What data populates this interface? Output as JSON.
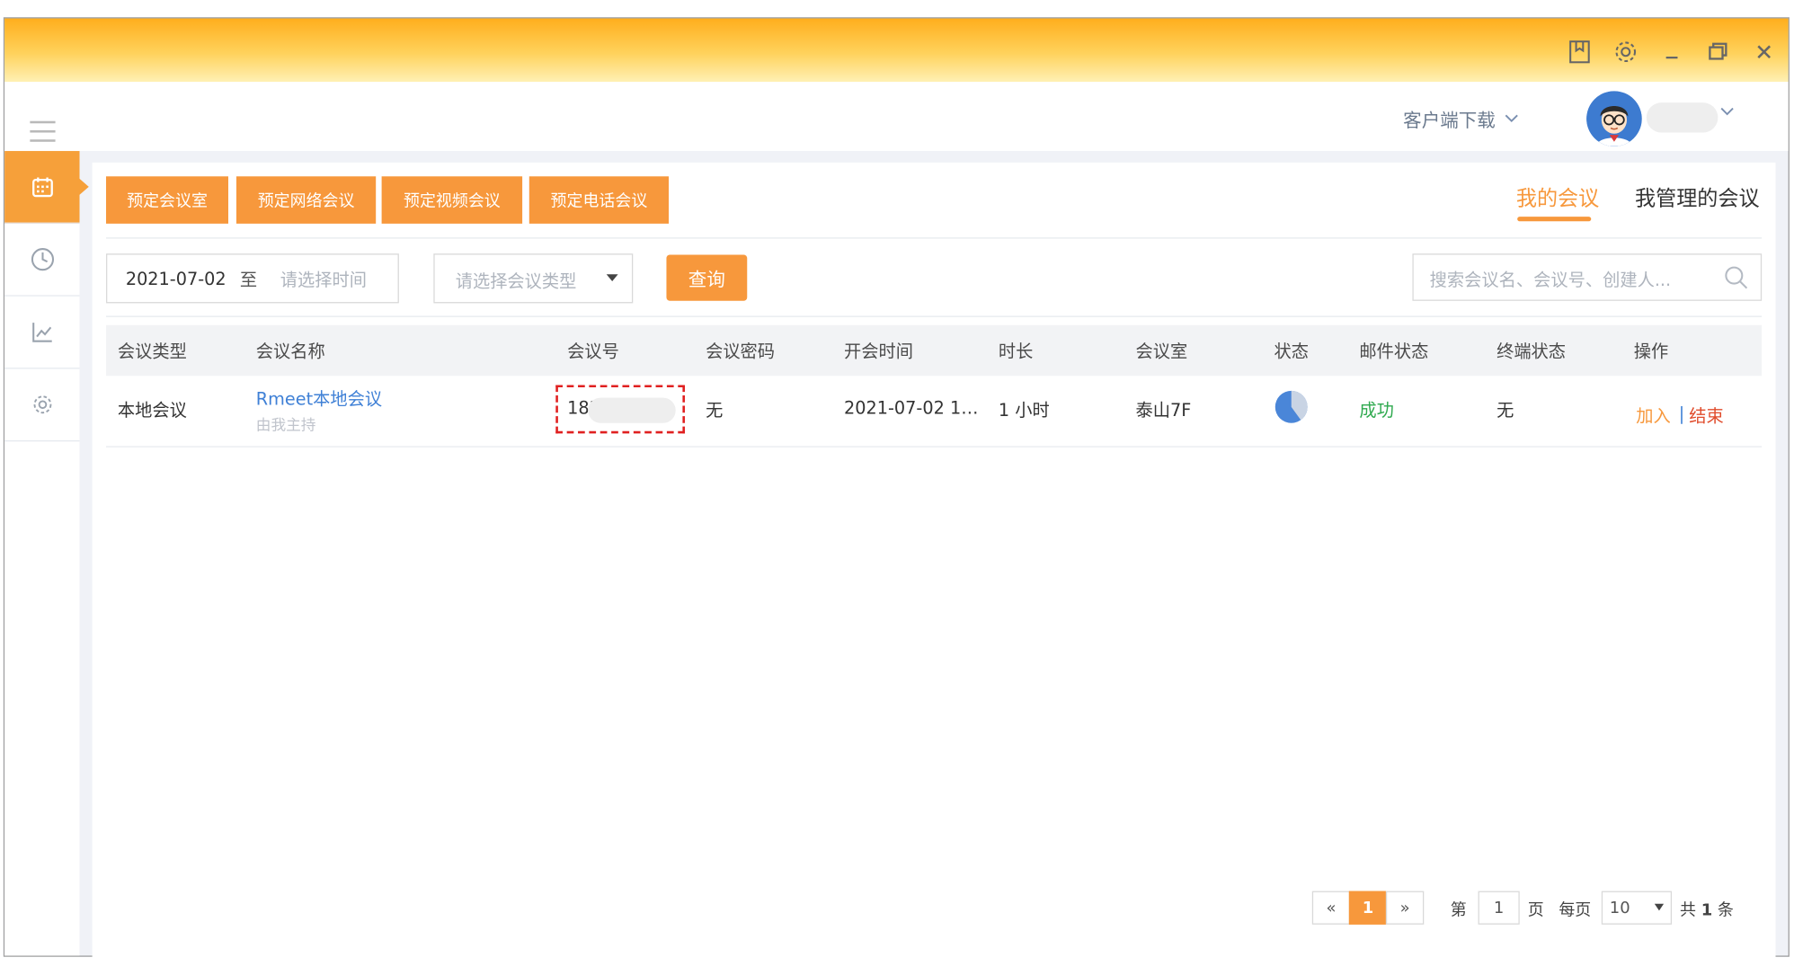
{
  "window": {
    "bookmark_icon": "bookmark-icon",
    "settings_icon": "gear-icon",
    "minimize_icon": "minimize-icon",
    "restore_icon": "restore-icon",
    "close_icon": "close-icon"
  },
  "header": {
    "client_download": "客户端下载"
  },
  "sidebar": {
    "items": [
      {
        "icon": "calendar-icon",
        "active": true
      },
      {
        "icon": "clock-icon",
        "active": false
      },
      {
        "icon": "chart-icon",
        "active": false
      },
      {
        "icon": "gear-icon",
        "active": false
      }
    ]
  },
  "actions": {
    "book_room": "预定会议室",
    "book_web": "预定网络会议",
    "book_video": "预定视频会议",
    "book_phone": "预定电话会议"
  },
  "tabs": {
    "mine": "我的会议",
    "managed": "我管理的会议"
  },
  "filters": {
    "start_date": "2021-07-02",
    "to": "至",
    "end_placeholder": "请选择时间",
    "type_placeholder": "请选择会议类型",
    "query": "查询",
    "search_placeholder": "搜索会议名、会议号、创建人..."
  },
  "table": {
    "headers": [
      "会议类型",
      "会议名称",
      "会议号",
      "会议密码",
      "开会时间",
      "时长",
      "会议室",
      "状态",
      "邮件状态",
      "终端状态",
      "操作"
    ],
    "rows": [
      {
        "type": "本地会议",
        "name": "Rmeet本地会议",
        "host": "由我主持",
        "number": "183",
        "password": "无",
        "time": "2021-07-02 1…",
        "duration": "1 小时",
        "room": "泰山7F",
        "status_progress": 0.6,
        "mail": "成功",
        "terminal": "无",
        "join": "加入",
        "sep": "|",
        "end": "结束"
      }
    ]
  },
  "pagination": {
    "prev": "«",
    "current": "1",
    "next": "»",
    "page_prefix": "第",
    "page_value": "1",
    "page_suffix": "页",
    "per_page_label": "每页",
    "per_page": "10",
    "total_prefix": "共",
    "total": "1",
    "total_suffix": "条"
  },
  "colors": {
    "accent": "#f7983c",
    "link": "#3f80d6",
    "success": "#2ea94e",
    "end": "#e04b2b"
  }
}
